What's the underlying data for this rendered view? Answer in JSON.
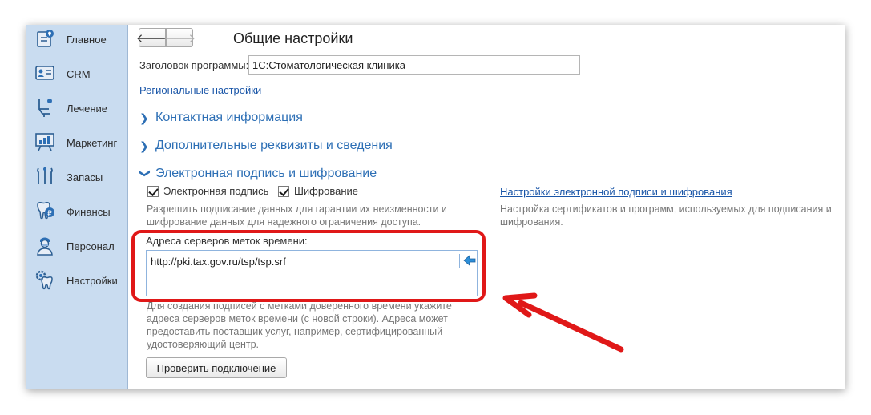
{
  "sidebar": {
    "items": [
      {
        "label": "Главное",
        "icon": "home-icon"
      },
      {
        "label": "CRM",
        "icon": "crm-card-icon"
      },
      {
        "label": "Лечение",
        "icon": "dental-chair-icon"
      },
      {
        "label": "Маркетинг",
        "icon": "chart-board-icon"
      },
      {
        "label": "Запасы",
        "icon": "dental-tools-icon"
      },
      {
        "label": "Финансы",
        "icon": "tooth-ruble-icon"
      },
      {
        "label": "Персонал",
        "icon": "doctor-icon"
      },
      {
        "label": "Настройки",
        "icon": "tooth-gear-icon"
      }
    ]
  },
  "header": {
    "back_symbol": "🡐",
    "forward_symbol": "🡒",
    "title": "Общие настройки"
  },
  "form": {
    "program_title_label": "Заголовок программы:",
    "program_title_value": "1С:Стоматологическая клиника",
    "regional_link": "Региональные настройки",
    "sections": {
      "contact": "Контактная информация",
      "additional": "Дополнительные реквизиты и сведения",
      "signature": "Электронная подпись и шифрование"
    },
    "checkboxes": {
      "signature_label": "Электронная подпись",
      "signature_checked": true,
      "encryption_label": "Шифрование",
      "encryption_checked": true
    },
    "signature_hint_line1": "Разрешить подписание данных для гарантии их неизменности и",
    "signature_hint_line2": "шифрование данных для надежного ограничения доступа.",
    "settings_link": "Настройки электронной подписи и шифрования",
    "settings_hint_line1": "Настройка сертификатов и программ, используемых для подписания и",
    "settings_hint_line2": "шифрования.",
    "servers_label": "Адреса серверов меток времени:",
    "servers_value": "http://pki.tax.gov.ru/tsp/tsp.srf",
    "servers_hint_line1": "Для создания подписей с метками доверенного времени укажите",
    "servers_hint_line2": "адреса серверов меток времени (с новой строки). Адреса может",
    "servers_hint_line3": "предоставить поставщик услуг, например, сертифицированный",
    "servers_hint_line4": "удостоверяющий центр.",
    "check_button": "Проверить подключение"
  },
  "colors": {
    "sidebar_bg": "#c9dcf0",
    "section_blue": "#2d6fb5",
    "link_blue": "#1a56a8",
    "highlight_red": "#e01818"
  }
}
